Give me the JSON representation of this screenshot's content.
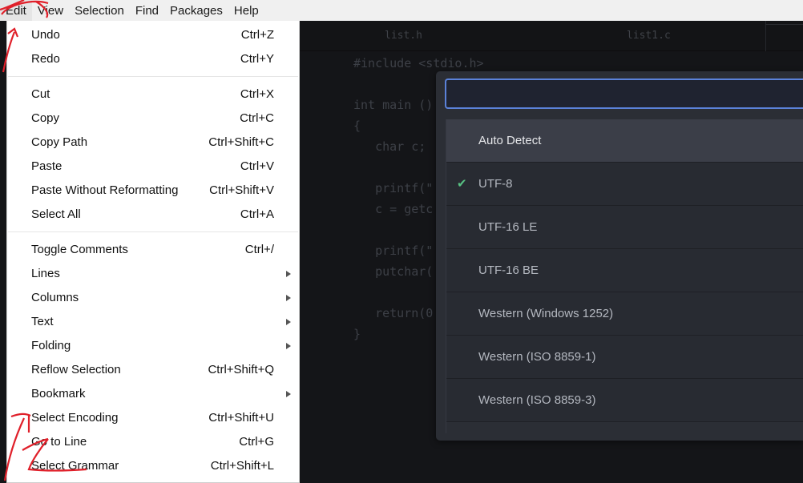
{
  "menubar": {
    "items": [
      "Edit",
      "View",
      "Selection",
      "Find",
      "Packages",
      "Help"
    ],
    "active": "Edit"
  },
  "tabs": [
    {
      "label": "list.h"
    },
    {
      "label": "list1.c"
    }
  ],
  "code": {
    "lines": [
      "#include <stdio.h>",
      "",
      "int main ()",
      "{",
      "   char c;",
      "",
      "   printf(\"",
      "   c = getc",
      "",
      "   printf(\"",
      "   putchar(",
      "",
      "   return(0",
      "}"
    ]
  },
  "edit_menu": {
    "groups": [
      [
        {
          "label": "Undo",
          "shortcut": "Ctrl+Z"
        },
        {
          "label": "Redo",
          "shortcut": "Ctrl+Y"
        }
      ],
      [
        {
          "label": "Cut",
          "shortcut": "Ctrl+X"
        },
        {
          "label": "Copy",
          "shortcut": "Ctrl+C"
        },
        {
          "label": "Copy Path",
          "shortcut": "Ctrl+Shift+C"
        },
        {
          "label": "Paste",
          "shortcut": "Ctrl+V"
        },
        {
          "label": "Paste Without Reformatting",
          "shortcut": "Ctrl+Shift+V"
        },
        {
          "label": "Select All",
          "shortcut": "Ctrl+A"
        }
      ],
      [
        {
          "label": "Toggle Comments",
          "shortcut": "Ctrl+/"
        },
        {
          "label": "Lines",
          "submenu": true
        },
        {
          "label": "Columns",
          "submenu": true
        },
        {
          "label": "Text",
          "submenu": true
        },
        {
          "label": "Folding",
          "submenu": true
        },
        {
          "label": "Reflow Selection",
          "shortcut": "Ctrl+Shift+Q"
        },
        {
          "label": "Bookmark",
          "submenu": true
        },
        {
          "label": "Select Encoding",
          "shortcut": "Ctrl+Shift+U"
        },
        {
          "label": "Go to Line",
          "shortcut": "Ctrl+G"
        },
        {
          "label": "Select Grammar",
          "shortcut": "Ctrl+Shift+L"
        }
      ]
    ]
  },
  "encoding_selector": {
    "query": "",
    "items": [
      {
        "label": "Auto Detect",
        "highlighted": true,
        "checked": false
      },
      {
        "label": "UTF-8",
        "highlighted": false,
        "checked": true
      },
      {
        "label": "UTF-16 LE",
        "highlighted": false,
        "checked": false
      },
      {
        "label": "UTF-16 BE",
        "highlighted": false,
        "checked": false
      },
      {
        "label": "Western (Windows 1252)",
        "highlighted": false,
        "checked": false
      },
      {
        "label": "Western (ISO 8859-1)",
        "highlighted": false,
        "checked": false
      },
      {
        "label": "Western (ISO 8859-3)",
        "highlighted": false,
        "checked": false
      }
    ],
    "check_glyph": "✔"
  },
  "colors": {
    "accent": "#5b82d9",
    "check": "#58c283",
    "annotation": "#e0202a"
  }
}
